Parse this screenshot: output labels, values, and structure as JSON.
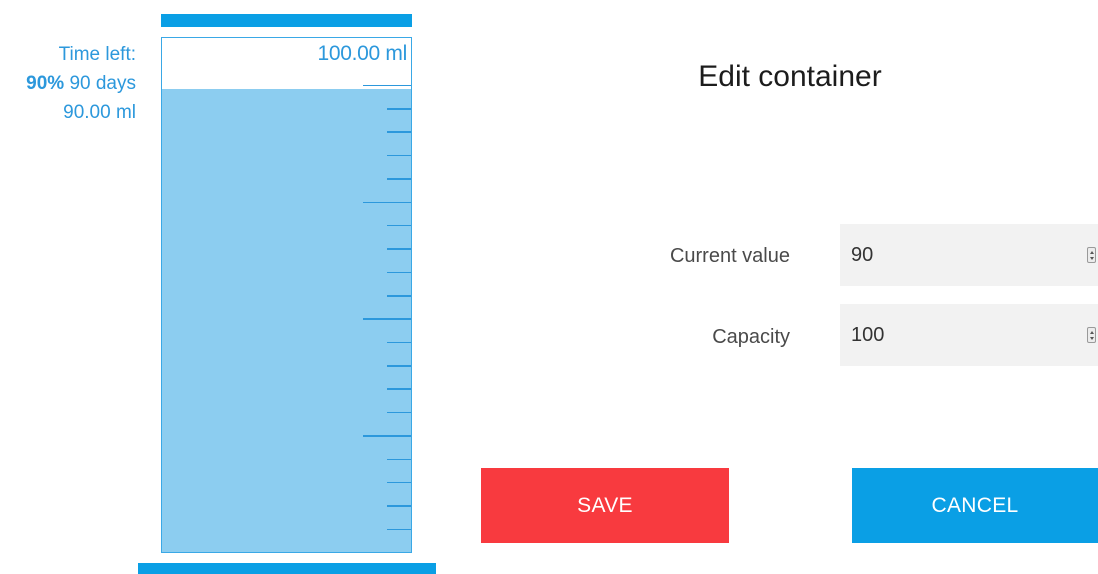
{
  "container": {
    "capacity_label": "100.00 ml",
    "fill_fraction": 0.9,
    "fill_color": "#8ccdf0",
    "accent_color": "#0a9fe5",
    "minor_tick_count": 22,
    "major_tick_every": 5
  },
  "status": {
    "time_left_label": "Time left:",
    "percent": "90%",
    "days": "90 days",
    "volume": "90.00 ml"
  },
  "form": {
    "title": "Edit container",
    "current_value_label": "Current value",
    "current_value": "90",
    "capacity_label": "Capacity",
    "capacity_value": "100",
    "save_label": "SAVE",
    "cancel_label": "CANCEL",
    "save_color": "#f83a3f",
    "cancel_color": "#0a9fe5"
  }
}
